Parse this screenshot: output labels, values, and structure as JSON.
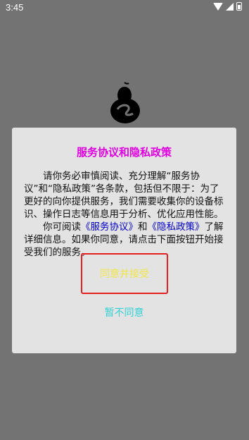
{
  "statusbar": {
    "time": "3:45",
    "icons": [
      "wifi-icon",
      "signal-icon",
      "battery-icon"
    ]
  },
  "app": {
    "logo": "app-logo"
  },
  "dialog": {
    "title": "服务协议和隐私政策",
    "paragraph1": "请你务必审慎阅读、充分理解“服务协议”和“隐私政策”各条款，包括但不限于：为了更好的向你提供服务，我们需要收集你的设备标识、操作日志等信息用于分析、优化应用性能。",
    "paragraph2_prefix": "你可阅读",
    "paragraph2_link1": "《服务协议》",
    "paragraph2_and": "和",
    "paragraph2_link2": "《隐私政策》",
    "paragraph2_suffix": "了解详细信息。如果你同意，请点击下面按钮开始接受我们的服务。",
    "accept_label": "同意并接受",
    "decline_label": "暂不同意"
  },
  "colors": {
    "background": "#737373",
    "dialog_bg": "#e3e3e3",
    "title": "#e000e0",
    "link": "#0000cc",
    "accept_text": "#f2e64a",
    "accept_border": "#e22020",
    "decline_text": "#33d0d6"
  }
}
